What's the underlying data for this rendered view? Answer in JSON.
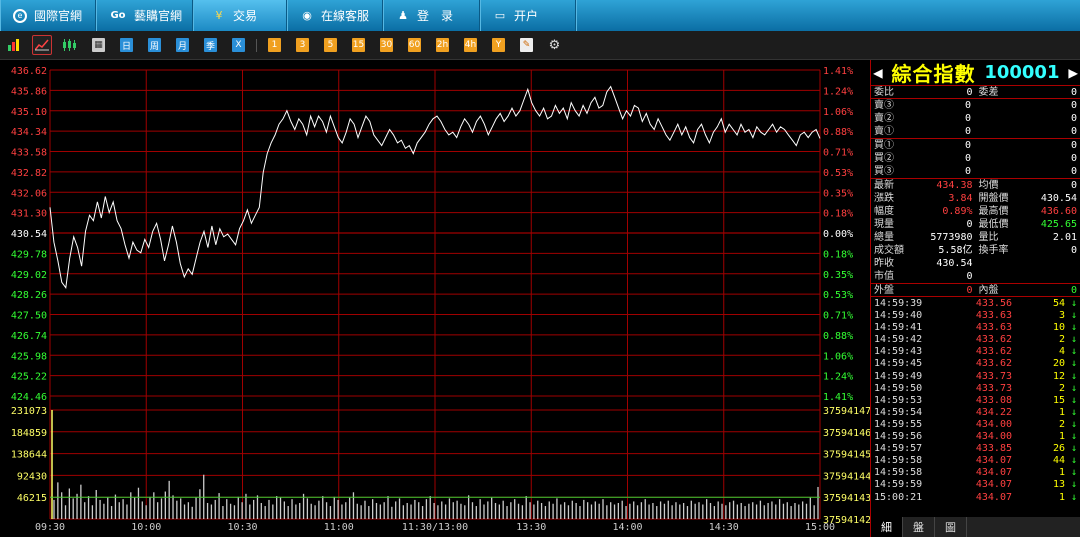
{
  "nav": [
    {
      "label": "國際官網",
      "icon": "globe-icon"
    },
    {
      "label": "藝購官網",
      "icon": "go-icon"
    },
    {
      "label": "交易",
      "icon": "yen-icon"
    },
    {
      "label": "在線客服",
      "icon": "eye-icon"
    },
    {
      "label": "登　录",
      "icon": "user-icon"
    },
    {
      "label": "开户",
      "icon": "monitor-icon"
    }
  ],
  "toolbar": {
    "period_labels": [
      "日",
      "周",
      "月",
      "季",
      "X"
    ],
    "minute_labels": [
      "1",
      "3",
      "5",
      "15",
      "30",
      "60",
      "2h",
      "4h",
      "Y"
    ]
  },
  "colors": {
    "up": "#ff4040",
    "down": "#33ff33",
    "grid": "#a00000",
    "price_line": "#ffffff",
    "volume": "#cccccc"
  },
  "chart_data": {
    "type": "line",
    "prev_close": 430.54,
    "price_ticks_left": [
      "436.62",
      "435.86",
      "435.10",
      "434.34",
      "433.58",
      "432.82",
      "432.06",
      "431.30",
      "430.54",
      "429.78",
      "429.02",
      "428.26",
      "427.50",
      "426.74",
      "425.98",
      "425.22",
      "424.46"
    ],
    "percent_ticks_right": [
      "1.41%",
      "1.24%",
      "1.06%",
      "0.88%",
      "0.71%",
      "0.53%",
      "0.35%",
      "0.18%",
      "0.00%",
      "0.18%",
      "0.35%",
      "0.53%",
      "0.71%",
      "0.88%",
      "1.06%",
      "1.24%",
      "1.41%"
    ],
    "ylim": [
      424.46,
      436.62
    ],
    "volume_ticks_left": [
      "231073",
      "184859",
      "138644",
      "92430",
      "46215"
    ],
    "volume_ticks_right": [
      "37594147",
      "37594146",
      "37594145",
      "37594144",
      "37594143",
      "37594142"
    ],
    "time_labels": [
      "09:30",
      "10:00",
      "10:30",
      "11:00",
      "11:30/13:00",
      "13:30",
      "14:00",
      "14:30",
      "15:00"
    ],
    "price": [
      431.5,
      430.2,
      429.5,
      428.7,
      428.5,
      429.6,
      430.4,
      430.0,
      429.3,
      430.6,
      431.2,
      431.0,
      431.7,
      431.1,
      431.9,
      431.3,
      431.7,
      431.0,
      430.7,
      430.1,
      429.6,
      430.2,
      429.9,
      429.8,
      430.3,
      430.0,
      430.6,
      430.9,
      430.3,
      429.5,
      430.1,
      430.8,
      430.2,
      429.4,
      428.9,
      429.2,
      429.0,
      429.6,
      430.2,
      430.6,
      430.0,
      430.8,
      430.1,
      430.7,
      430.4,
      430.5,
      430.3,
      430.1,
      430.7,
      431.0,
      431.4,
      430.9,
      431.2,
      431.5,
      432.8,
      433.5,
      433.9,
      434.2,
      434.6,
      434.8,
      435.1,
      434.7,
      434.4,
      434.8,
      434.6,
      434.2,
      434.9,
      434.5,
      434.9,
      434.7,
      434.3,
      434.9,
      434.5,
      434.1,
      433.9,
      434.3,
      434.8,
      434.6,
      434.1,
      434.5,
      434.9,
      434.7,
      434.2,
      434.0,
      433.8,
      434.1,
      434.4,
      434.2,
      433.9,
      434.0,
      433.7,
      433.8,
      433.5,
      433.9,
      434.1,
      434.3,
      434.6,
      434.8,
      434.9,
      434.7,
      434.4,
      434.2,
      434.3,
      434.1,
      434.5,
      434.8,
      434.6,
      434.3,
      434.7,
      434.9,
      434.6,
      434.2,
      434.5,
      434.8,
      435.0,
      434.7,
      434.9,
      435.2,
      434.9,
      435.1,
      435.5,
      435.9,
      435.4,
      435.1,
      434.9,
      435.2,
      434.8,
      434.9,
      435.3,
      435.0,
      435.2,
      434.8,
      435.4,
      435.1,
      434.9,
      435.3,
      435.0,
      435.4,
      435.6,
      435.2,
      435.3,
      435.8,
      436.0,
      435.6,
      435.2,
      434.8,
      435.1,
      434.9,
      435.3,
      435.2,
      434.7,
      435.0,
      434.6,
      434.4,
      434.8,
      434.5,
      434.2,
      434.0,
      434.3,
      434.6,
      434.2,
      434.5,
      434.1,
      433.9,
      434.4,
      434.6,
      434.2,
      433.9,
      434.3,
      434.5,
      434.8,
      434.3,
      434.6,
      434.4,
      434.2,
      434.6,
      434.3,
      434.4,
      434.1,
      434.5,
      434.3,
      434.2,
      434.4,
      434.6,
      434.3,
      434.5,
      434.4,
      434.2,
      434.0,
      433.8,
      434.2,
      434.3,
      434.1,
      434.3,
      434.4,
      434.07
    ],
    "avg": [],
    "volume": [
      25,
      48,
      35,
      18,
      40,
      27,
      33,
      45,
      22,
      30,
      18,
      38,
      25,
      20,
      28,
      17,
      32,
      22,
      26,
      19,
      35,
      28,
      41,
      23,
      18,
      29,
      35,
      22,
      27,
      36,
      50,
      31,
      24,
      27,
      19,
      22,
      16,
      28,
      39,
      58,
      21,
      19,
      25,
      34,
      17,
      26,
      20,
      18,
      29,
      22,
      33,
      19,
      25,
      31,
      21,
      17,
      25,
      19,
      30,
      28,
      23,
      17,
      26,
      19,
      21,
      33,
      27,
      20,
      18,
      24,
      30,
      22,
      17,
      29,
      25,
      19,
      22,
      28,
      35,
      20,
      18,
      24,
      17,
      26,
      21,
      19,
      22,
      30,
      16,
      23,
      27,
      18,
      21,
      19,
      25,
      22,
      17,
      26,
      30,
      21,
      18,
      23,
      19,
      27,
      22,
      24,
      20,
      18,
      31,
      22,
      17,
      26,
      19,
      23,
      28,
      21,
      19,
      24,
      17,
      22,
      26,
      20,
      18,
      30,
      22,
      19,
      24,
      21,
      17,
      23,
      20,
      27,
      19,
      22,
      18,
      24,
      21,
      17,
      25,
      22,
      19,
      23,
      20,
      26,
      18,
      22,
      19,
      21,
      24,
      17,
      20,
      23,
      18,
      22,
      26,
      19,
      21,
      17,
      23,
      20,
      24,
      18,
      22,
      19,
      21,
      17,
      24,
      20,
      22,
      19,
      26,
      21,
      17,
      23,
      20,
      18,
      22,
      24,
      19,
      21,
      17,
      20,
      22,
      19,
      24,
      18,
      21,
      23,
      19,
      26,
      20,
      22,
      17,
      21,
      19,
      23,
      20,
      28,
      18,
      42
    ],
    "first_volume_spike": 231073,
    "volume_ylim": [
      0,
      231073
    ]
  },
  "quote": {
    "title": "綜合指數",
    "code": "100001",
    "weibi_label": "委比",
    "weibi": "0",
    "weicha_label": "委差",
    "weicha": "0",
    "sell": [
      {
        "label": "賣③",
        "price": "0",
        "vol": "0"
      },
      {
        "label": "賣②",
        "price": "0",
        "vol": "0"
      },
      {
        "label": "賣①",
        "price": "0",
        "vol": "0"
      }
    ],
    "buy": [
      {
        "label": "買①",
        "price": "0",
        "vol": "0"
      },
      {
        "label": "買②",
        "price": "0",
        "vol": "0"
      },
      {
        "label": "買③",
        "price": "0",
        "vol": "0"
      }
    ],
    "stats": [
      {
        "l1": "最新",
        "v1": "434.38",
        "c1": "red",
        "l2": "均價",
        "v2": "0",
        "c2": "white"
      },
      {
        "l1": "漲跌",
        "v1": "3.84",
        "c1": "red",
        "l2": "開盤價",
        "v2": "430.54",
        "c2": "white"
      },
      {
        "l1": "幅度",
        "v1": "0.89%",
        "c1": "red",
        "l2": "最高價",
        "v2": "436.60",
        "c2": "red"
      },
      {
        "l1": "現量",
        "v1": "0",
        "c1": "white",
        "l2": "最低價",
        "v2": "425.65",
        "c2": "green"
      },
      {
        "l1": "總量",
        "v1": "5773980",
        "c1": "white",
        "l2": "量比",
        "v2": "2.01",
        "c2": "white"
      },
      {
        "l1": "成交額",
        "v1": "5.58亿",
        "c1": "white",
        "l2": "換手率",
        "v2": "0",
        "c2": "white"
      },
      {
        "l1": "昨收",
        "v1": "430.54",
        "c1": "white",
        "l2": "",
        "v2": "",
        "c2": "white"
      },
      {
        "l1": "市值",
        "v1": "0",
        "c1": "white",
        "l2": "",
        "v2": "",
        "c2": "white"
      }
    ],
    "waipan_label": "外盤",
    "waipan": "0",
    "neipan_label": "內盤",
    "neipan": "0",
    "ticks": [
      {
        "time": "14:59:39",
        "price": "433.56",
        "vol": "54"
      },
      {
        "time": "14:59:40",
        "price": "433.63",
        "vol": "3"
      },
      {
        "time": "14:59:41",
        "price": "433.63",
        "vol": "10"
      },
      {
        "time": "14:59:42",
        "price": "433.62",
        "vol": "2"
      },
      {
        "time": "14:59:43",
        "price": "433.62",
        "vol": "4"
      },
      {
        "time": "14:59:45",
        "price": "433.62",
        "vol": "20"
      },
      {
        "time": "14:59:49",
        "price": "433.73",
        "vol": "12"
      },
      {
        "time": "14:59:50",
        "price": "433.73",
        "vol": "2"
      },
      {
        "time": "14:59:53",
        "price": "433.08",
        "vol": "15"
      },
      {
        "time": "14:59:54",
        "price": "434.22",
        "vol": "1"
      },
      {
        "time": "14:59:55",
        "price": "434.00",
        "vol": "2"
      },
      {
        "time": "14:59:56",
        "price": "434.00",
        "vol": "1"
      },
      {
        "time": "14:59:57",
        "price": "433.85",
        "vol": "26"
      },
      {
        "time": "14:59:58",
        "price": "434.07",
        "vol": "44"
      },
      {
        "time": "14:59:58",
        "price": "434.07",
        "vol": "1"
      },
      {
        "time": "14:59:59",
        "price": "434.07",
        "vol": "13"
      },
      {
        "time": "15:00:21",
        "price": "434.07",
        "vol": "1"
      }
    ],
    "tabs": [
      "細",
      "盤",
      "圖"
    ]
  }
}
